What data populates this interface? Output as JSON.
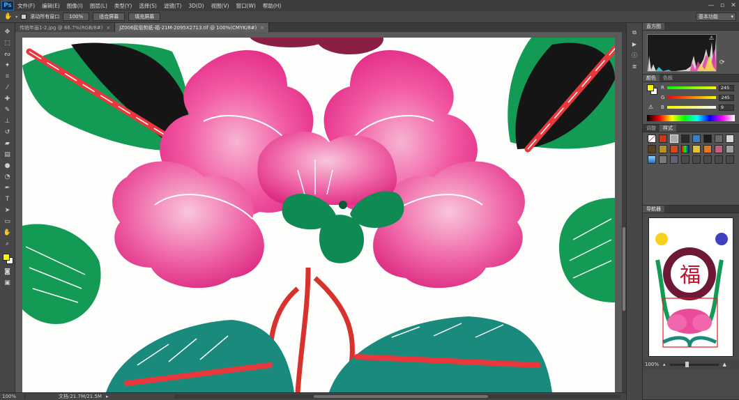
{
  "menubar": {
    "logo": "Ps",
    "items": [
      "文件(F)",
      "编辑(E)",
      "图像(I)",
      "图层(L)",
      "类型(Y)",
      "选择(S)",
      "滤镜(T)",
      "3D(D)",
      "视图(V)",
      "窗口(W)",
      "帮助(H)"
    ],
    "window_controls": [
      "—",
      "▫",
      "✕"
    ]
  },
  "options": {
    "scroll_all_label": "滚动所有窗口",
    "zoom_label": "100%",
    "fit_screen_label": "适合屏幕",
    "fill_screen_label": "填充屏幕",
    "workspace_label": "基本功能"
  },
  "tabs": [
    {
      "label": "传统年画1-2.jpg @ 66.7%(RGB/8#)",
      "active": false
    },
    {
      "label": "JZ006民俗剪纸-福-21M-2095X2713.tif @ 100%(CMYK/8#)",
      "active": true
    }
  ],
  "tools": [
    "move-icon",
    "marquee-icon",
    "lasso-icon",
    "magic-wand-icon",
    "crop-icon",
    "eyedropper-icon",
    "healing-icon",
    "brush-icon",
    "stamp-icon",
    "history-brush-icon",
    "eraser-icon",
    "gradient-icon",
    "blur-icon",
    "dodge-icon",
    "pen-icon",
    "type-icon",
    "path-select-icon",
    "shape-icon",
    "hand-icon",
    "zoom-icon"
  ],
  "colors": {
    "foreground": "#f5f509",
    "background": "#ffffff"
  },
  "status": {
    "zoom": "100%",
    "doc": "文档:21.7M/21.5M"
  },
  "panels": {
    "histogram": {
      "tab": "直方图"
    },
    "color": {
      "tabs": [
        "颜色",
        "色板"
      ],
      "channels": [
        {
          "name": "R",
          "value": "245"
        },
        {
          "name": "G",
          "value": "245"
        },
        {
          "name": "B",
          "value": "9"
        }
      ]
    },
    "styles": {
      "tabs": [
        "调整",
        "样式"
      ]
    },
    "navigator": {
      "tab": "导航器",
      "zoom": "100%"
    }
  }
}
